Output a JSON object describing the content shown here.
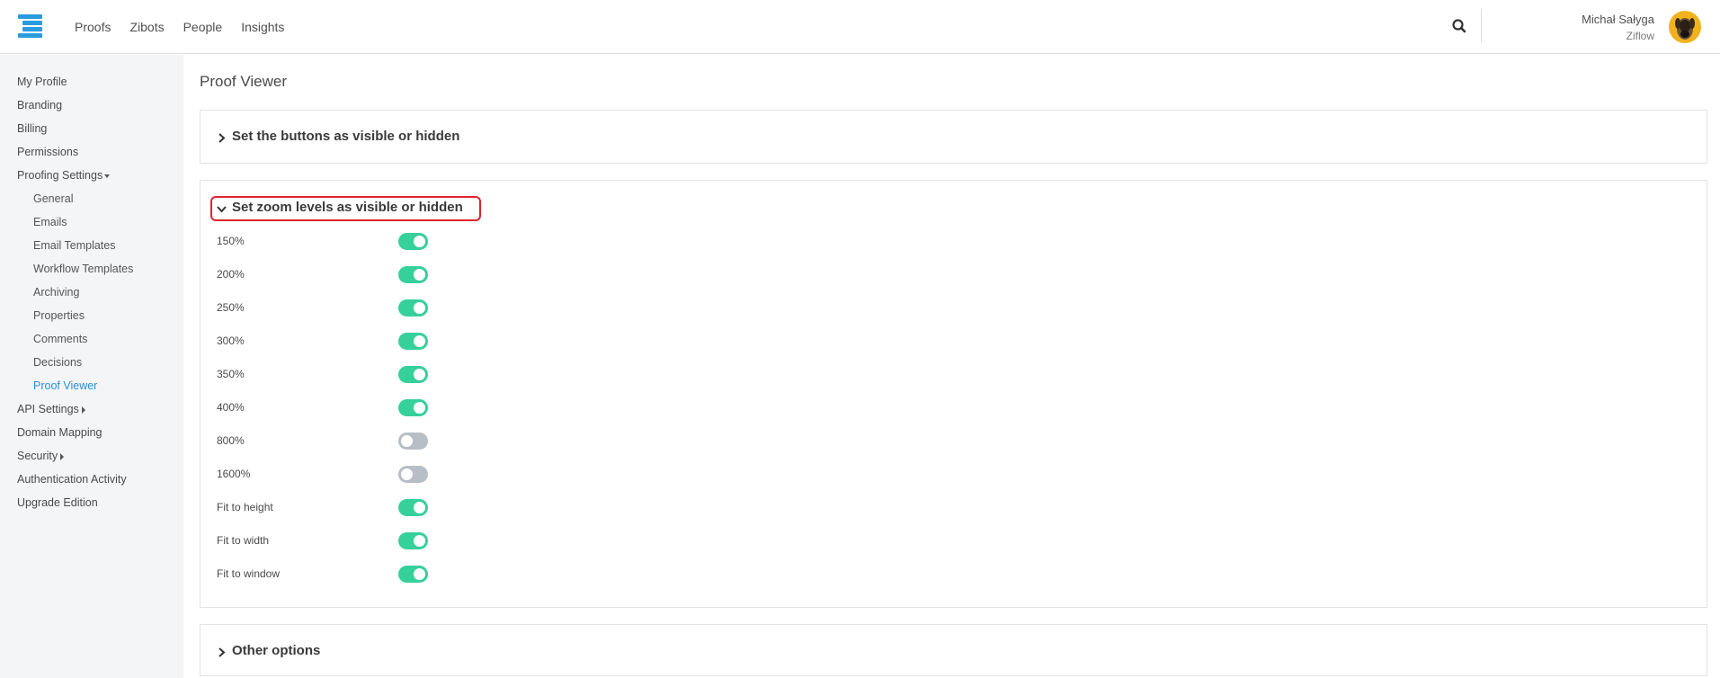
{
  "header": {
    "nav": [
      "Proofs",
      "Zibots",
      "People",
      "Insights"
    ],
    "user_name": "Michał Sałyga",
    "user_org": "Ziflow",
    "accent_color": "#2a9be0"
  },
  "sidebar": {
    "items": [
      {
        "label": "My Profile"
      },
      {
        "label": "Branding"
      },
      {
        "label": "Billing"
      },
      {
        "label": "Permissions"
      },
      {
        "label": "Proofing Settings",
        "expanded": true
      },
      {
        "label": "General"
      },
      {
        "label": "Emails"
      },
      {
        "label": "Email Templates"
      },
      {
        "label": "Workflow Templates"
      },
      {
        "label": "Archiving"
      },
      {
        "label": "Properties"
      },
      {
        "label": "Comments"
      },
      {
        "label": "Decisions"
      },
      {
        "label": "Proof Viewer",
        "active": true
      },
      {
        "label": "API Settings",
        "expanded": false
      },
      {
        "label": "Domain Mapping"
      },
      {
        "label": "Security",
        "expanded": false
      },
      {
        "label": "Authentication Activity"
      },
      {
        "label": "Upgrade Edition"
      }
    ]
  },
  "main": {
    "title": "Proof Viewer",
    "panels": [
      {
        "title": "Set the buttons as visible or hidden",
        "expanded": false
      },
      {
        "title": "Set zoom levels as visible or hidden",
        "expanded": true
      },
      {
        "title": "Other options",
        "expanded": false
      }
    ],
    "zoom_levels": [
      {
        "label": "150%",
        "enabled": true
      },
      {
        "label": "200%",
        "enabled": true
      },
      {
        "label": "250%",
        "enabled": true
      },
      {
        "label": "300%",
        "enabled": true
      },
      {
        "label": "350%",
        "enabled": true
      },
      {
        "label": "400%",
        "enabled": true
      },
      {
        "label": "800%",
        "enabled": false
      },
      {
        "label": "1600%",
        "enabled": false
      },
      {
        "label": "Fit to height",
        "enabled": true
      },
      {
        "label": "Fit to width",
        "enabled": true
      },
      {
        "label": "Fit to window",
        "enabled": true
      }
    ],
    "toggle_on_color": "#36d09a",
    "toggle_off_color": "#b8bec6",
    "highlight_color": "#e0242e"
  }
}
